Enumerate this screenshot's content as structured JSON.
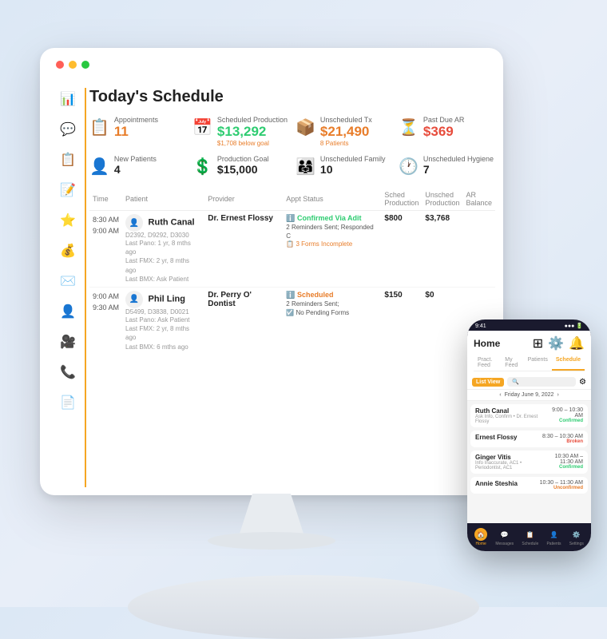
{
  "page": {
    "title": "Today's Schedule",
    "traffic_lights": [
      "red",
      "yellow",
      "green"
    ]
  },
  "stats_row1": [
    {
      "icon": "📋",
      "label": "Appointments",
      "value": "11",
      "sub": "",
      "color": "orange",
      "icon_color": "#f5a623"
    },
    {
      "icon": "📅",
      "label": "Scheduled Production",
      "value": "$13,292",
      "sub": "$1,708 below goal",
      "color": "green",
      "icon_color": "#2ecc71"
    },
    {
      "icon": "📦",
      "label": "Unscheduled Tx",
      "value": "$21,490",
      "sub": "8 Patients",
      "color": "orange",
      "icon_color": "#f5a623"
    },
    {
      "icon": "⏳",
      "label": "Past Due AR",
      "value": "$369",
      "sub": "",
      "color": "red",
      "icon_color": "#e74c3c"
    }
  ],
  "stats_row2": [
    {
      "icon": "👤",
      "label": "New Patients",
      "value": "4",
      "color": "orange"
    },
    {
      "icon": "💲",
      "label": "Production Goal",
      "value": "$15,000",
      "color": "orange"
    },
    {
      "icon": "👨‍👩‍👧",
      "label": "Unscheduled Family",
      "value": "10",
      "color": "orange"
    },
    {
      "icon": "🕐",
      "label": "Unscheduled Hygiene",
      "value": "7",
      "color": "orange"
    }
  ],
  "table": {
    "headers": [
      "Time",
      "Patient",
      "Provider",
      "Appt Status",
      "Sched Production",
      "Unsched Production",
      "AR Balance"
    ],
    "rows": [
      {
        "time1": "8:30 AM",
        "time2": "9:00 AM",
        "patient_name": "Ruth Canal",
        "patient_codes": "D2392, D9292, D3030",
        "patient_info1": "Last Pano: 1 yr, 8 mths ago",
        "patient_info2": "Last FMX: 2 yr, 8 mths ago",
        "patient_info3": "Last BMX: Ask Patient",
        "provider": "Dr. Ernest Flossy",
        "status_label": "Confirmed Via Adit",
        "status_color": "green",
        "status_detail1": "2 Reminders Sent; Responded C",
        "status_warning": "3 Forms Incomplete",
        "sched_prod": "$800",
        "unsched_prod": "$3,768",
        "ar_balance": ""
      },
      {
        "time1": "9:00 AM",
        "time2": "9:30 AM",
        "patient_name": "Phil Ling",
        "patient_codes": "D5499, D3838, D0021",
        "patient_info1": "Last Pano: Ask Patient",
        "patient_info2": "Last FMX: 2 yr, 8 mths ago",
        "patient_info3": "Last BMX: 6 mths ago",
        "provider": "Dr. Perry O' Dontist",
        "status_label": "Scheduled",
        "status_color": "orange",
        "status_detail1": "2 Reminders Sent;",
        "status_warning": "No Pending Forms",
        "sched_prod": "$150",
        "unsched_prod": "$0",
        "ar_balance": ""
      }
    ]
  },
  "sidebar": {
    "icons": [
      "📊",
      "💬",
      "📋",
      "📝",
      "⭐",
      "💰",
      "✉️",
      "👤",
      "🎥",
      "📞",
      "📄"
    ]
  },
  "phone": {
    "status_bar_time": "9:41",
    "header_title": "Home",
    "tabs": [
      "Pract. Feed",
      "My Feed",
      "Patients",
      "Schedule"
    ],
    "active_tab": "Schedule",
    "view_mode": "List View",
    "date_label": "Friday June 9, 2022",
    "appointments": [
      {
        "name": "Ruth Canal",
        "detail": "Ask Info, Confirm • Dr. Ernest Flossy",
        "time": "9:00 – 10:30 AM",
        "status": "Confirmed",
        "status_class": "status-confirmed-p"
      },
      {
        "name": "Ernest Flossy",
        "detail": "",
        "time": "8:30 – 10:30 AM",
        "status": "Broken",
        "status_class": "status-broken"
      },
      {
        "name": "Ginger Vitis",
        "detail": "Info Inaccurate, AC1 • Periodontist, AC1",
        "time": "10:30 AM – 11:30 AM",
        "status": "Confirmed",
        "status_class": "status-confirmed-p"
      },
      {
        "name": "Annie Steshia",
        "detail": "",
        "time": "10:30 – 11:30 AM",
        "status": "Unconfirmed",
        "status_class": "status-unscheduled"
      }
    ],
    "bottom_nav": [
      "🏠",
      "💬",
      "📋",
      "👤",
      "⚙️"
    ],
    "bottom_nav_labels": [
      "Home",
      "Messages",
      "Schedule",
      "Patients",
      "Settings"
    ],
    "active_nav": 0
  }
}
